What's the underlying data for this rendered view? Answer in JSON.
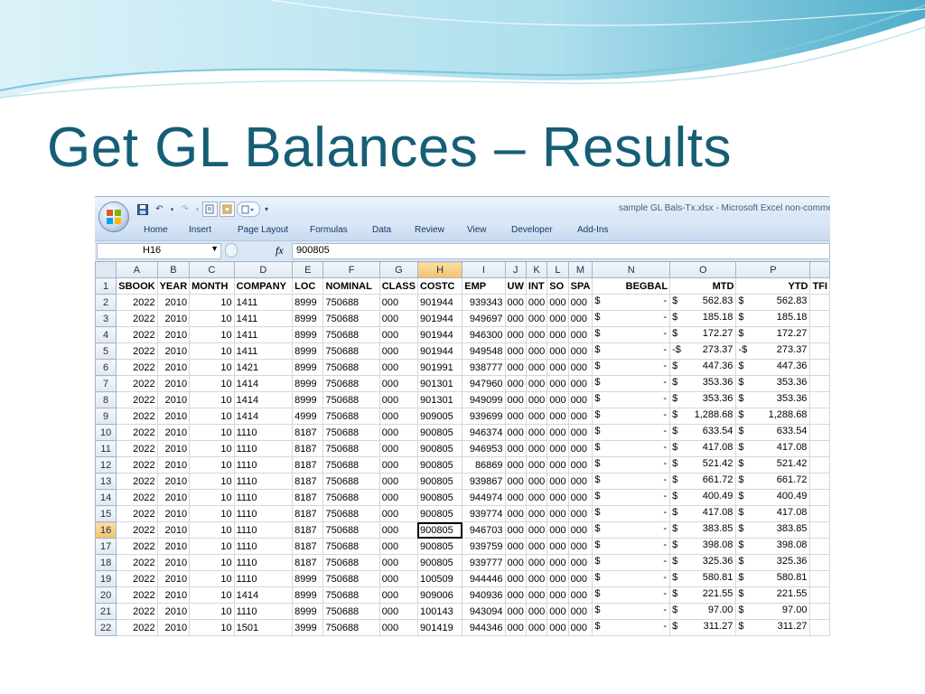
{
  "slide": {
    "title": "Get GL Balances – Results"
  },
  "window": {
    "title": "sample GL Bals-Tx.xlsx - Microsoft Excel non-comme"
  },
  "ribbon_tabs": [
    "Home",
    "Insert",
    "Page Layout",
    "Formulas",
    "Data",
    "Review",
    "View",
    "Developer",
    "Add-Ins"
  ],
  "formula_bar": {
    "name_box": "H16",
    "fx": "fx",
    "value": "900805"
  },
  "active_cell": "H16",
  "columns": [
    "A",
    "B",
    "C",
    "D",
    "E",
    "F",
    "G",
    "H",
    "I",
    "J",
    "K",
    "L",
    "M",
    "N",
    "O",
    "P",
    ""
  ],
  "header_row": [
    "SBOOK",
    "YEAR",
    "MONTH",
    "COMPANY",
    "LOC",
    "NOMINAL",
    "CLASS",
    "COSTC",
    "EMP",
    "UW",
    "INT",
    "SO",
    "SPA",
    "BEGBAL",
    "MTD",
    "YTD",
    "TFI"
  ],
  "rows": [
    {
      "n": "2",
      "a": "2022",
      "b": "2010",
      "c": "10",
      "d": "1411",
      "e": "8999",
      "f": "750688",
      "g": "000",
      "h": "901944",
      "i": "939343",
      "j": "000",
      "k": "000",
      "l": "000",
      "m": "000",
      "nd": "$",
      "nv": "-",
      "od": "$",
      "ov": "562.83",
      "pd": "$",
      "pv": "562.83"
    },
    {
      "n": "3",
      "a": "2022",
      "b": "2010",
      "c": "10",
      "d": "1411",
      "e": "8999",
      "f": "750688",
      "g": "000",
      "h": "901944",
      "i": "949697",
      "j": "000",
      "k": "000",
      "l": "000",
      "m": "000",
      "nd": "$",
      "nv": "-",
      "od": "$",
      "ov": "185.18",
      "pd": "$",
      "pv": "185.18"
    },
    {
      "n": "4",
      "a": "2022",
      "b": "2010",
      "c": "10",
      "d": "1411",
      "e": "8999",
      "f": "750688",
      "g": "000",
      "h": "901944",
      "i": "946300",
      "j": "000",
      "k": "000",
      "l": "000",
      "m": "000",
      "nd": "$",
      "nv": "-",
      "od": "$",
      "ov": "172.27",
      "pd": "$",
      "pv": "172.27"
    },
    {
      "n": "5",
      "a": "2022",
      "b": "2010",
      "c": "10",
      "d": "1411",
      "e": "8999",
      "f": "750688",
      "g": "000",
      "h": "901944",
      "i": "949548",
      "j": "000",
      "k": "000",
      "l": "000",
      "m": "000",
      "nd": "$",
      "nv": "-",
      "od": "-$",
      "ov": "273.37",
      "pd": "-$",
      "pv": "273.37"
    },
    {
      "n": "6",
      "a": "2022",
      "b": "2010",
      "c": "10",
      "d": "1421",
      "e": "8999",
      "f": "750688",
      "g": "000",
      "h": "901991",
      "i": "938777",
      "j": "000",
      "k": "000",
      "l": "000",
      "m": "000",
      "nd": "$",
      "nv": "-",
      "od": "$",
      "ov": "447.36",
      "pd": "$",
      "pv": "447.36"
    },
    {
      "n": "7",
      "a": "2022",
      "b": "2010",
      "c": "10",
      "d": "1414",
      "e": "8999",
      "f": "750688",
      "g": "000",
      "h": "901301",
      "i": "947960",
      "j": "000",
      "k": "000",
      "l": "000",
      "m": "000",
      "nd": "$",
      "nv": "-",
      "od": "$",
      "ov": "353.36",
      "pd": "$",
      "pv": "353.36"
    },
    {
      "n": "8",
      "a": "2022",
      "b": "2010",
      "c": "10",
      "d": "1414",
      "e": "8999",
      "f": "750688",
      "g": "000",
      "h": "901301",
      "i": "949099",
      "j": "000",
      "k": "000",
      "l": "000",
      "m": "000",
      "nd": "$",
      "nv": "-",
      "od": "$",
      "ov": "353.36",
      "pd": "$",
      "pv": "353.36"
    },
    {
      "n": "9",
      "a": "2022",
      "b": "2010",
      "c": "10",
      "d": "1414",
      "e": "4999",
      "f": "750688",
      "g": "000",
      "h": "909005",
      "i": "939699",
      "j": "000",
      "k": "000",
      "l": "000",
      "m": "000",
      "nd": "$",
      "nv": "-",
      "od": "$",
      "ov": "1,288.68",
      "pd": "$",
      "pv": "1,288.68"
    },
    {
      "n": "10",
      "a": "2022",
      "b": "2010",
      "c": "10",
      "d": "1110",
      "e": "8187",
      "f": "750688",
      "g": "000",
      "h": "900805",
      "i": "946374",
      "j": "000",
      "k": "000",
      "l": "000",
      "m": "000",
      "nd": "$",
      "nv": "-",
      "od": "$",
      "ov": "633.54",
      "pd": "$",
      "pv": "633.54"
    },
    {
      "n": "11",
      "a": "2022",
      "b": "2010",
      "c": "10",
      "d": "1110",
      "e": "8187",
      "f": "750688",
      "g": "000",
      "h": "900805",
      "i": "946953",
      "j": "000",
      "k": "000",
      "l": "000",
      "m": "000",
      "nd": "$",
      "nv": "-",
      "od": "$",
      "ov": "417.08",
      "pd": "$",
      "pv": "417.08"
    },
    {
      "n": "12",
      "a": "2022",
      "b": "2010",
      "c": "10",
      "d": "1110",
      "e": "8187",
      "f": "750688",
      "g": "000",
      "h": "900805",
      "i": "86869",
      "j": "000",
      "k": "000",
      "l": "000",
      "m": "000",
      "nd": "$",
      "nv": "-",
      "od": "$",
      "ov": "521.42",
      "pd": "$",
      "pv": "521.42"
    },
    {
      "n": "13",
      "a": "2022",
      "b": "2010",
      "c": "10",
      "d": "1110",
      "e": "8187",
      "f": "750688",
      "g": "000",
      "h": "900805",
      "i": "939867",
      "j": "000",
      "k": "000",
      "l": "000",
      "m": "000",
      "nd": "$",
      "nv": "-",
      "od": "$",
      "ov": "661.72",
      "pd": "$",
      "pv": "661.72"
    },
    {
      "n": "14",
      "a": "2022",
      "b": "2010",
      "c": "10",
      "d": "1110",
      "e": "8187",
      "f": "750688",
      "g": "000",
      "h": "900805",
      "i": "944974",
      "j": "000",
      "k": "000",
      "l": "000",
      "m": "000",
      "nd": "$",
      "nv": "-",
      "od": "$",
      "ov": "400.49",
      "pd": "$",
      "pv": "400.49"
    },
    {
      "n": "15",
      "a": "2022",
      "b": "2010",
      "c": "10",
      "d": "1110",
      "e": "8187",
      "f": "750688",
      "g": "000",
      "h": "900805",
      "i": "939774",
      "j": "000",
      "k": "000",
      "l": "000",
      "m": "000",
      "nd": "$",
      "nv": "-",
      "od": "$",
      "ov": "417.08",
      "pd": "$",
      "pv": "417.08"
    },
    {
      "n": "16",
      "a": "2022",
      "b": "2010",
      "c": "10",
      "d": "1110",
      "e": "8187",
      "f": "750688",
      "g": "000",
      "h": "900805",
      "i": "946703",
      "j": "000",
      "k": "000",
      "l": "000",
      "m": "000",
      "nd": "$",
      "nv": "-",
      "od": "$",
      "ov": "383.85",
      "pd": "$",
      "pv": "383.85"
    },
    {
      "n": "17",
      "a": "2022",
      "b": "2010",
      "c": "10",
      "d": "1110",
      "e": "8187",
      "f": "750688",
      "g": "000",
      "h": "900805",
      "i": "939759",
      "j": "000",
      "k": "000",
      "l": "000",
      "m": "000",
      "nd": "$",
      "nv": "-",
      "od": "$",
      "ov": "398.08",
      "pd": "$",
      "pv": "398.08"
    },
    {
      "n": "18",
      "a": "2022",
      "b": "2010",
      "c": "10",
      "d": "1110",
      "e": "8187",
      "f": "750688",
      "g": "000",
      "h": "900805",
      "i": "939777",
      "j": "000",
      "k": "000",
      "l": "000",
      "m": "000",
      "nd": "$",
      "nv": "-",
      "od": "$",
      "ov": "325.36",
      "pd": "$",
      "pv": "325.36"
    },
    {
      "n": "19",
      "a": "2022",
      "b": "2010",
      "c": "10",
      "d": "1110",
      "e": "8999",
      "f": "750688",
      "g": "000",
      "h": "100509",
      "i": "944446",
      "j": "000",
      "k": "000",
      "l": "000",
      "m": "000",
      "nd": "$",
      "nv": "-",
      "od": "$",
      "ov": "580.81",
      "pd": "$",
      "pv": "580.81"
    },
    {
      "n": "20",
      "a": "2022",
      "b": "2010",
      "c": "10",
      "d": "1414",
      "e": "8999",
      "f": "750688",
      "g": "000",
      "h": "909006",
      "i": "940936",
      "j": "000",
      "k": "000",
      "l": "000",
      "m": "000",
      "nd": "$",
      "nv": "-",
      "od": "$",
      "ov": "221.55",
      "pd": "$",
      "pv": "221.55"
    },
    {
      "n": "21",
      "a": "2022",
      "b": "2010",
      "c": "10",
      "d": "1110",
      "e": "8999",
      "f": "750688",
      "g": "000",
      "h": "100143",
      "i": "943094",
      "j": "000",
      "k": "000",
      "l": "000",
      "m": "000",
      "nd": "$",
      "nv": "-",
      "od": "$",
      "ov": "97.00",
      "pd": "$",
      "pv": "97.00"
    },
    {
      "n": "22",
      "a": "2022",
      "b": "2010",
      "c": "10",
      "d": "1501",
      "e": "3999",
      "f": "750688",
      "g": "000",
      "h": "901419",
      "i": "944346",
      "j": "000",
      "k": "000",
      "l": "000",
      "m": "000",
      "nd": "$",
      "nv": "-",
      "od": "$",
      "ov": "311.27",
      "pd": "$",
      "pv": "311.27"
    }
  ],
  "colors": {
    "title": "#155e75",
    "wave_light": "#bfe6f2",
    "wave_dark": "#1f8fb0",
    "selected_header": "#f4c26a"
  },
  "icons": [
    "office-button-icon",
    "save-icon",
    "undo-icon",
    "redo-icon",
    "print-preview-icon",
    "quick-print-icon",
    "customize-qat-icon",
    "formula-cancel-icon",
    "fx-icon",
    "name-box-dropdown-icon"
  ]
}
